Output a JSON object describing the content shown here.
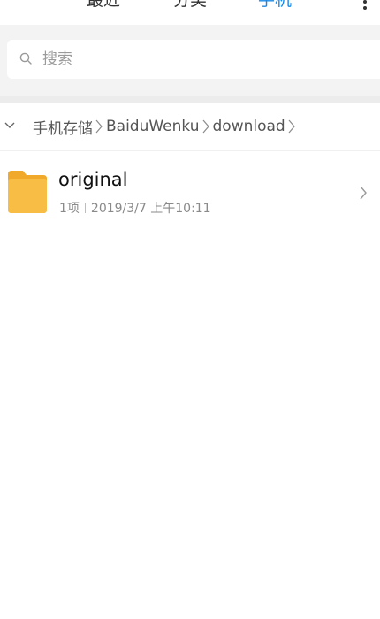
{
  "tabs": [
    {
      "label": "最近"
    },
    {
      "label": "分类"
    },
    {
      "label": "手机",
      "active": true
    }
  ],
  "search": {
    "placeholder": "搜索"
  },
  "breadcrumb": {
    "items": [
      "手机存储",
      "BaiduWenku",
      "download"
    ]
  },
  "files": [
    {
      "name": "original",
      "count": "1项",
      "modified": "2019/3/7 上午10:11",
      "icon": "folder-icon"
    }
  ],
  "colors": {
    "accent": "#1a88e6",
    "folder": "#f5b83d",
    "folder_tab": "#f0a92a"
  }
}
